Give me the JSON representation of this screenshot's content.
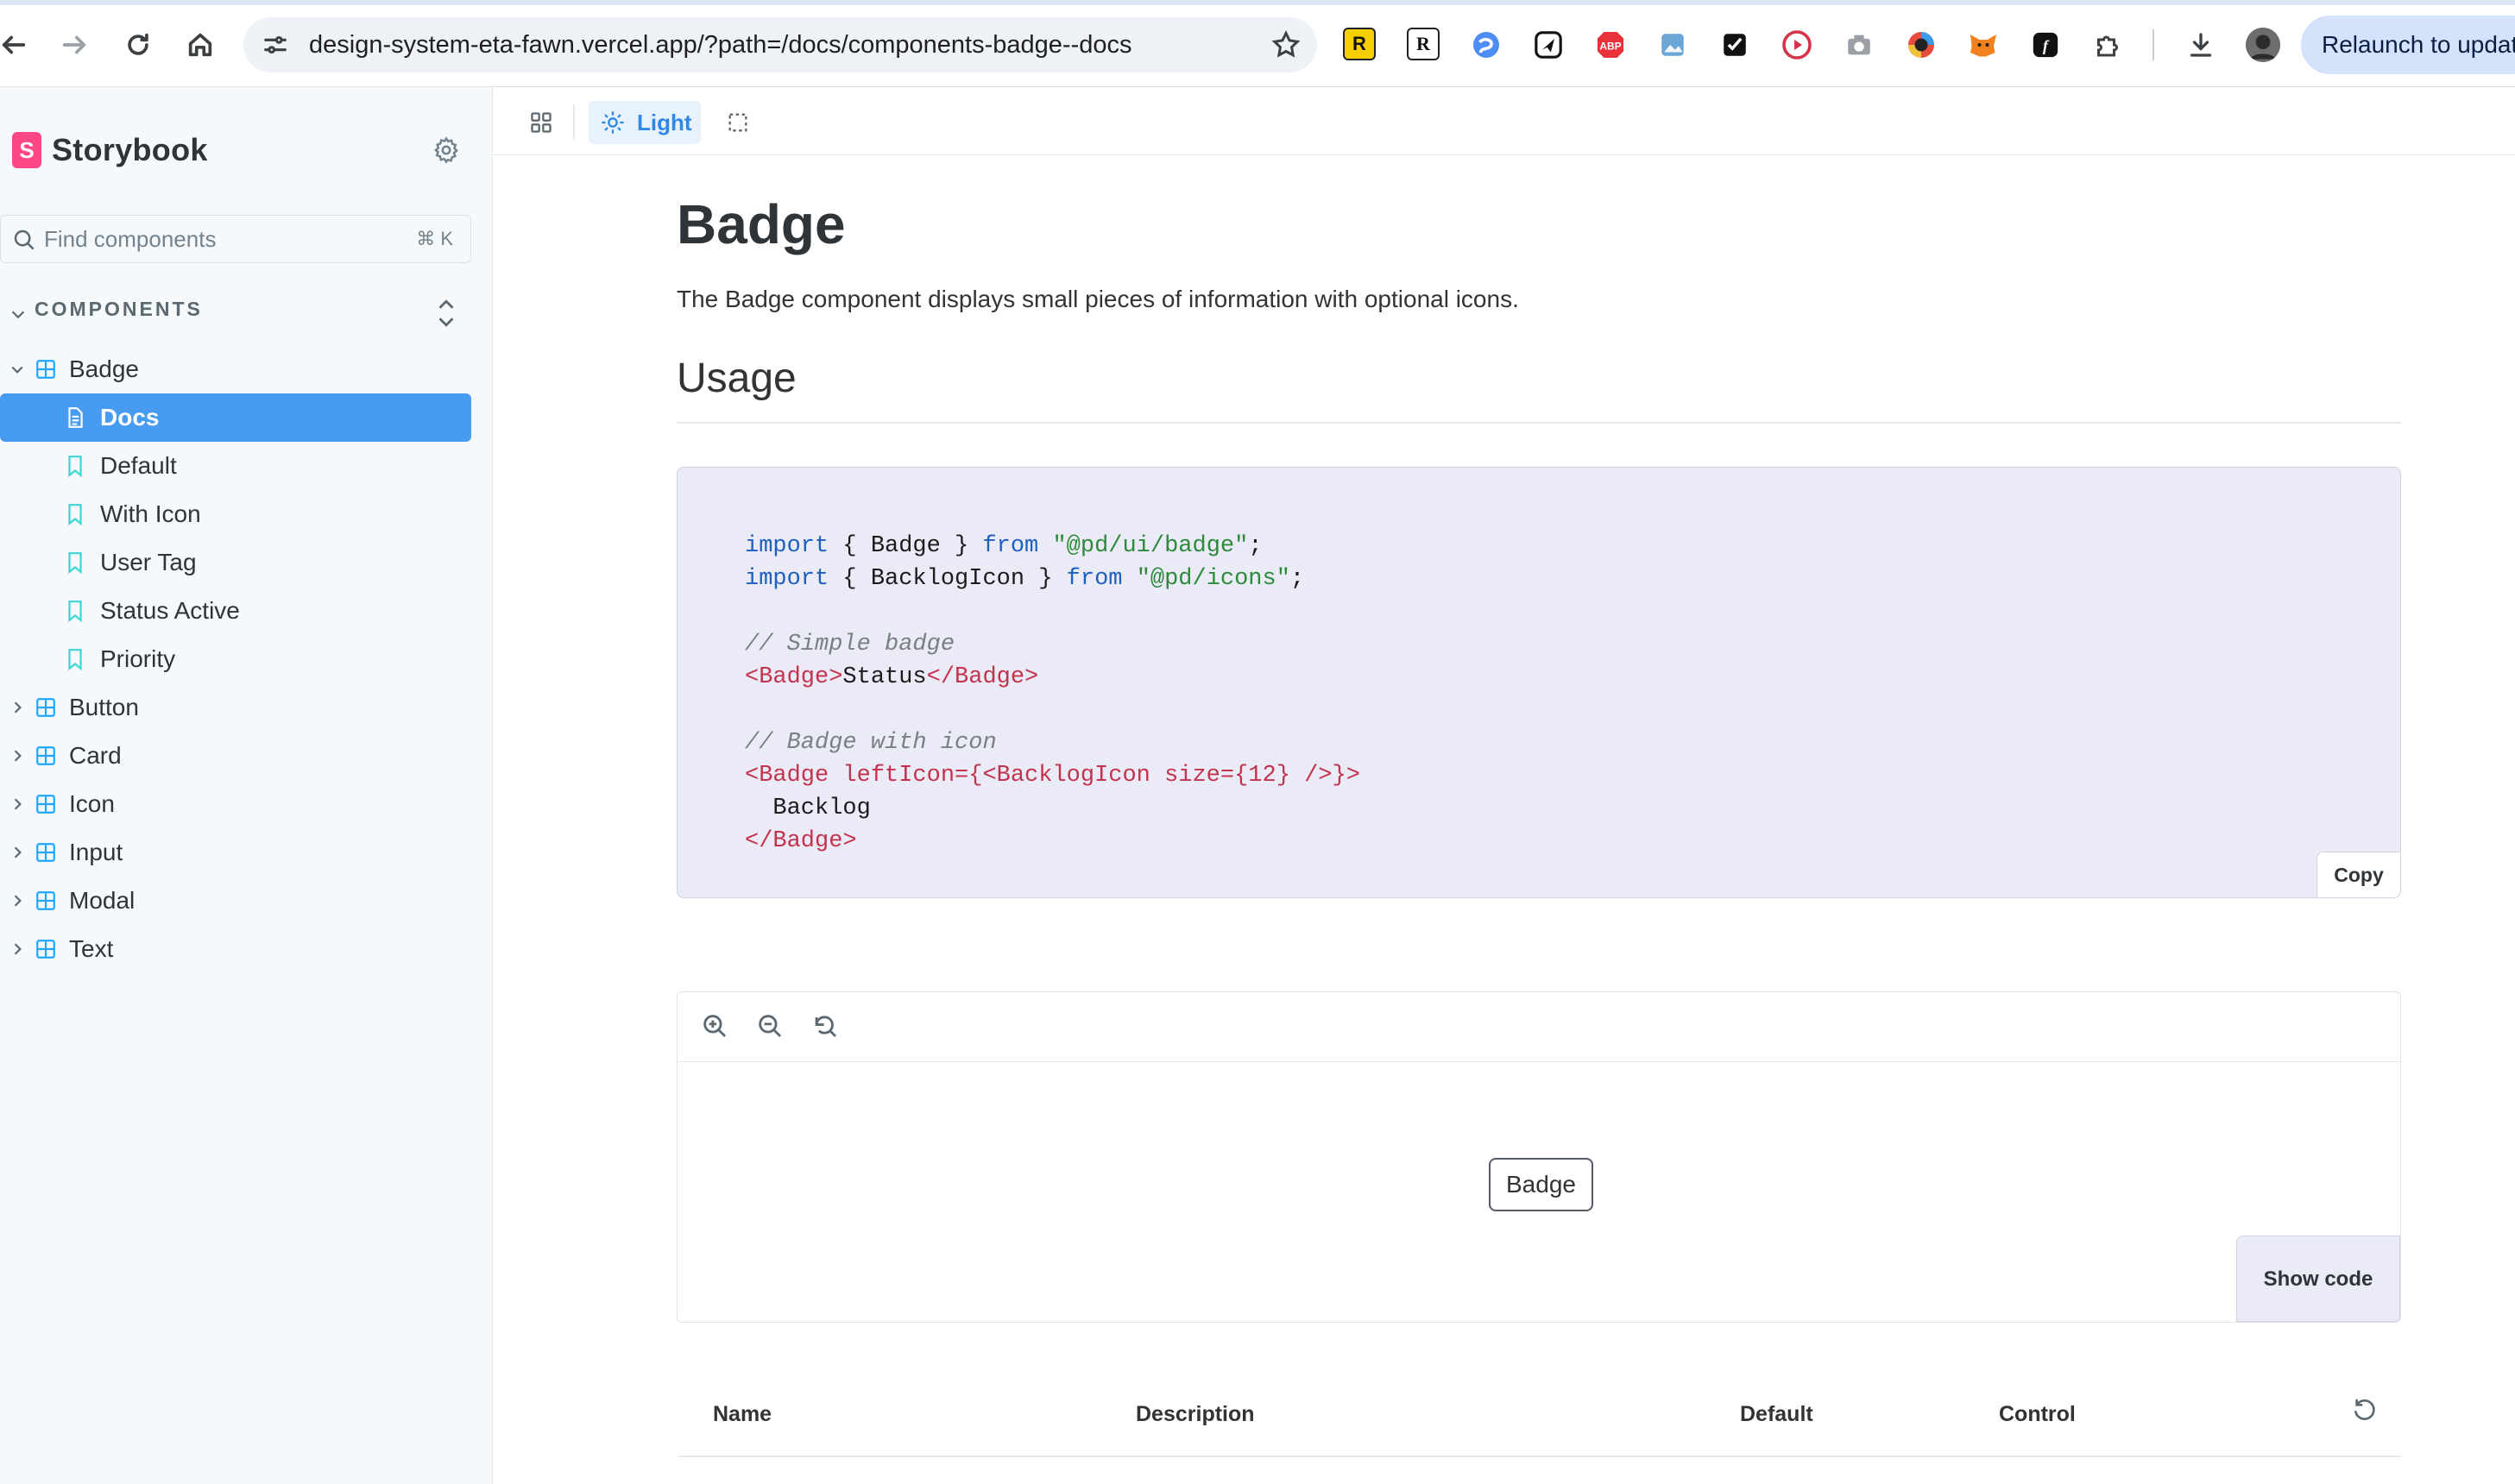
{
  "browser": {
    "url": "design-system-eta-fawn.vercel.app/?path=/docs/components-badge--docs",
    "relaunch_label": "Relaunch to updat",
    "extension_badges": [
      "R",
      "R",
      "ABP"
    ]
  },
  "sidebar": {
    "brand": "Storybook",
    "logo_letter": "S",
    "search_placeholder": "Find components",
    "search_shortcut": "⌘ K",
    "section_title": "COMPONENTS",
    "tree": [
      {
        "label": "Badge",
        "expanded": true
      },
      {
        "label": "Docs",
        "selected": true
      },
      {
        "label": "Default"
      },
      {
        "label": "With Icon"
      },
      {
        "label": "User Tag"
      },
      {
        "label": "Status Active"
      },
      {
        "label": "Priority"
      },
      {
        "label": "Button"
      },
      {
        "label": "Card"
      },
      {
        "label": "Icon"
      },
      {
        "label": "Input"
      },
      {
        "label": "Modal"
      },
      {
        "label": "Text"
      }
    ]
  },
  "toolbar": {
    "theme_label": "Light"
  },
  "doc": {
    "title": "Badge",
    "description": "The Badge component displays small pieces of information with optional icons.",
    "usage_heading": "Usage",
    "code": {
      "line1_kw1": "import",
      "line1_mid": " { Badge } ",
      "line1_kw2": "from",
      "line1_str": "\"@pd/ui/badge\"",
      "line1_end": ";",
      "line2_kw1": "import",
      "line2_mid": " { BacklogIcon } ",
      "line2_kw2": "from",
      "line2_str": "\"@pd/icons\"",
      "line2_end": ";",
      "comment1": "// Simple badge",
      "open_tag1": "<Badge>",
      "text1": "Status",
      "close_tag1": "</Badge>",
      "comment2": "// Badge with icon",
      "open_tag2": "<Badge leftIcon={<BacklogIcon size={12} />}>",
      "text2": "  Backlog",
      "close_tag2": "</Badge>"
    },
    "copy_label": "Copy",
    "preview_badge": "Badge",
    "show_code_label": "Show code",
    "props_headers": {
      "name": "Name",
      "description": "Description",
      "default": "Default",
      "control": "Control"
    }
  }
}
